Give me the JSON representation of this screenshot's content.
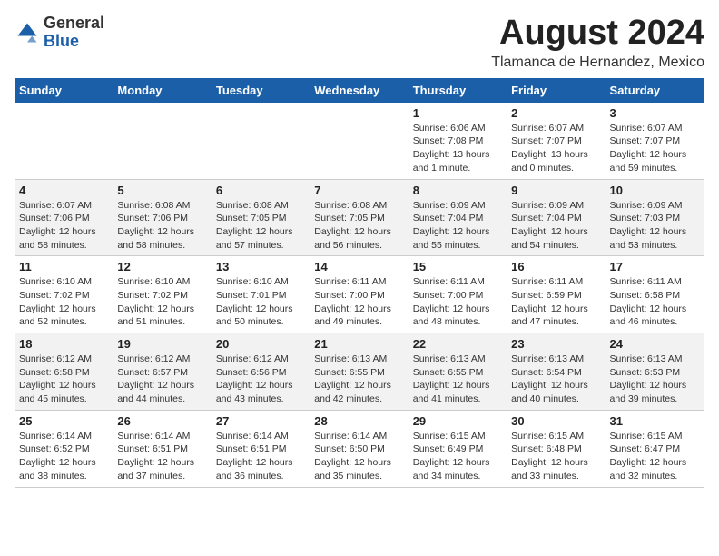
{
  "header": {
    "logo_general": "General",
    "logo_blue": "Blue",
    "month_year": "August 2024",
    "location": "Tlamanca de Hernandez, Mexico"
  },
  "calendar": {
    "days_of_week": [
      "Sunday",
      "Monday",
      "Tuesday",
      "Wednesday",
      "Thursday",
      "Friday",
      "Saturday"
    ],
    "weeks": [
      [
        {
          "day": "",
          "info": ""
        },
        {
          "day": "",
          "info": ""
        },
        {
          "day": "",
          "info": ""
        },
        {
          "day": "",
          "info": ""
        },
        {
          "day": "1",
          "info": "Sunrise: 6:06 AM\nSunset: 7:08 PM\nDaylight: 13 hours\nand 1 minute."
        },
        {
          "day": "2",
          "info": "Sunrise: 6:07 AM\nSunset: 7:07 PM\nDaylight: 13 hours\nand 0 minutes."
        },
        {
          "day": "3",
          "info": "Sunrise: 6:07 AM\nSunset: 7:07 PM\nDaylight: 12 hours\nand 59 minutes."
        }
      ],
      [
        {
          "day": "4",
          "info": "Sunrise: 6:07 AM\nSunset: 7:06 PM\nDaylight: 12 hours\nand 58 minutes."
        },
        {
          "day": "5",
          "info": "Sunrise: 6:08 AM\nSunset: 7:06 PM\nDaylight: 12 hours\nand 58 minutes."
        },
        {
          "day": "6",
          "info": "Sunrise: 6:08 AM\nSunset: 7:05 PM\nDaylight: 12 hours\nand 57 minutes."
        },
        {
          "day": "7",
          "info": "Sunrise: 6:08 AM\nSunset: 7:05 PM\nDaylight: 12 hours\nand 56 minutes."
        },
        {
          "day": "8",
          "info": "Sunrise: 6:09 AM\nSunset: 7:04 PM\nDaylight: 12 hours\nand 55 minutes."
        },
        {
          "day": "9",
          "info": "Sunrise: 6:09 AM\nSunset: 7:04 PM\nDaylight: 12 hours\nand 54 minutes."
        },
        {
          "day": "10",
          "info": "Sunrise: 6:09 AM\nSunset: 7:03 PM\nDaylight: 12 hours\nand 53 minutes."
        }
      ],
      [
        {
          "day": "11",
          "info": "Sunrise: 6:10 AM\nSunset: 7:02 PM\nDaylight: 12 hours\nand 52 minutes."
        },
        {
          "day": "12",
          "info": "Sunrise: 6:10 AM\nSunset: 7:02 PM\nDaylight: 12 hours\nand 51 minutes."
        },
        {
          "day": "13",
          "info": "Sunrise: 6:10 AM\nSunset: 7:01 PM\nDaylight: 12 hours\nand 50 minutes."
        },
        {
          "day": "14",
          "info": "Sunrise: 6:11 AM\nSunset: 7:00 PM\nDaylight: 12 hours\nand 49 minutes."
        },
        {
          "day": "15",
          "info": "Sunrise: 6:11 AM\nSunset: 7:00 PM\nDaylight: 12 hours\nand 48 minutes."
        },
        {
          "day": "16",
          "info": "Sunrise: 6:11 AM\nSunset: 6:59 PM\nDaylight: 12 hours\nand 47 minutes."
        },
        {
          "day": "17",
          "info": "Sunrise: 6:11 AM\nSunset: 6:58 PM\nDaylight: 12 hours\nand 46 minutes."
        }
      ],
      [
        {
          "day": "18",
          "info": "Sunrise: 6:12 AM\nSunset: 6:58 PM\nDaylight: 12 hours\nand 45 minutes."
        },
        {
          "day": "19",
          "info": "Sunrise: 6:12 AM\nSunset: 6:57 PM\nDaylight: 12 hours\nand 44 minutes."
        },
        {
          "day": "20",
          "info": "Sunrise: 6:12 AM\nSunset: 6:56 PM\nDaylight: 12 hours\nand 43 minutes."
        },
        {
          "day": "21",
          "info": "Sunrise: 6:13 AM\nSunset: 6:55 PM\nDaylight: 12 hours\nand 42 minutes."
        },
        {
          "day": "22",
          "info": "Sunrise: 6:13 AM\nSunset: 6:55 PM\nDaylight: 12 hours\nand 41 minutes."
        },
        {
          "day": "23",
          "info": "Sunrise: 6:13 AM\nSunset: 6:54 PM\nDaylight: 12 hours\nand 40 minutes."
        },
        {
          "day": "24",
          "info": "Sunrise: 6:13 AM\nSunset: 6:53 PM\nDaylight: 12 hours\nand 39 minutes."
        }
      ],
      [
        {
          "day": "25",
          "info": "Sunrise: 6:14 AM\nSunset: 6:52 PM\nDaylight: 12 hours\nand 38 minutes."
        },
        {
          "day": "26",
          "info": "Sunrise: 6:14 AM\nSunset: 6:51 PM\nDaylight: 12 hours\nand 37 minutes."
        },
        {
          "day": "27",
          "info": "Sunrise: 6:14 AM\nSunset: 6:51 PM\nDaylight: 12 hours\nand 36 minutes."
        },
        {
          "day": "28",
          "info": "Sunrise: 6:14 AM\nSunset: 6:50 PM\nDaylight: 12 hours\nand 35 minutes."
        },
        {
          "day": "29",
          "info": "Sunrise: 6:15 AM\nSunset: 6:49 PM\nDaylight: 12 hours\nand 34 minutes."
        },
        {
          "day": "30",
          "info": "Sunrise: 6:15 AM\nSunset: 6:48 PM\nDaylight: 12 hours\nand 33 minutes."
        },
        {
          "day": "31",
          "info": "Sunrise: 6:15 AM\nSunset: 6:47 PM\nDaylight: 12 hours\nand 32 minutes."
        }
      ]
    ]
  }
}
